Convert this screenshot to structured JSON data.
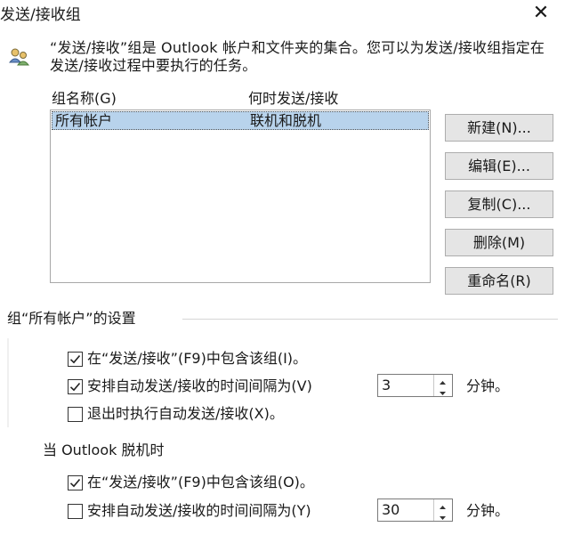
{
  "window": {
    "title": "发送/接收组",
    "close_label": "✕"
  },
  "intro": {
    "text": "“发送/接收”组是 Outlook 帐户和文件夹的集合。您可以为发送/接收组指定在发送/接收过程中要执行的任务。"
  },
  "group_list": {
    "columns": [
      "组名称(G)",
      "何时发送/接收"
    ],
    "rows": [
      {
        "name": "所有帐户",
        "when": "联机和脱机",
        "selected": true
      }
    ]
  },
  "buttons": {
    "new": "新建(N)...",
    "edit": "编辑(E)...",
    "copy": "复制(C)...",
    "delete": "删除(M)",
    "rename": "重命名(R)"
  },
  "settings": {
    "section_title": "组“所有帐户”的设置",
    "online": {
      "include_label": "在“发送/接收”(F9)中包含该组(I)。",
      "include_checked": true,
      "schedule_label": "安排自动发送/接收的时间间隔为(V)",
      "schedule_checked": true,
      "interval_value": "3",
      "unit": "分钟。",
      "exit_label": "退出时执行自动发送/接收(X)。",
      "exit_checked": false
    },
    "offline": {
      "heading": "当 Outlook 脱机时",
      "include_label": "在“发送/接收”(F9)中包含该组(O)。",
      "include_checked": true,
      "schedule_label": "安排自动发送/接收的时间间隔为(Y)",
      "schedule_checked": false,
      "interval_value": "30",
      "unit": "分钟。"
    }
  }
}
